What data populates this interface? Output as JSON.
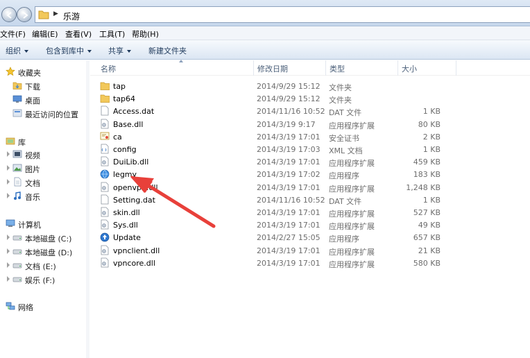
{
  "address": {
    "path_segment": "乐游"
  },
  "menu": [
    {
      "id": "file",
      "label": "文件(F)"
    },
    {
      "id": "edit",
      "label": "编辑(E)"
    },
    {
      "id": "view",
      "label": "查看(V)"
    },
    {
      "id": "tools",
      "label": "工具(T)"
    },
    {
      "id": "help",
      "label": "帮助(H)"
    }
  ],
  "toolbar": {
    "organize": "组织",
    "include_library": "包含到库中",
    "share": "共享",
    "new_folder": "新建文件夹"
  },
  "nav": {
    "favorites": "收藏夹",
    "downloads": "下载",
    "desktop": "桌面",
    "recent": "最近访问的位置",
    "libraries": "库",
    "videos": "视频",
    "pictures": "图片",
    "documents": "文档",
    "music": "音乐",
    "computer": "计算机",
    "drive_c": "本地磁盘 (C:)",
    "drive_d": "本地磁盘 (D:)",
    "drive_e": "文档 (E:)",
    "drive_f": "娱乐 (F:)",
    "network": "网络"
  },
  "columns": {
    "name": "名称",
    "date": "修改日期",
    "type": "类型",
    "size": "大小"
  },
  "files": [
    {
      "name": "tap",
      "date": "2014/9/29 15:12",
      "type": "文件夹",
      "size": "",
      "icon": "folder-icon"
    },
    {
      "name": "tap64",
      "date": "2014/9/29 15:12",
      "type": "文件夹",
      "size": "",
      "icon": "folder-icon"
    },
    {
      "name": "Access.dat",
      "date": "2014/11/16 10:52",
      "type": "DAT 文件",
      "size": "1 KB",
      "icon": "file-icon"
    },
    {
      "name": "Base.dll",
      "date": "2014/3/19 9:17",
      "type": "应用程序扩展",
      "size": "80 KB",
      "icon": "dll-icon"
    },
    {
      "name": "ca",
      "date": "2014/3/19 17:01",
      "type": "安全证书",
      "size": "2 KB",
      "icon": "certificate-icon"
    },
    {
      "name": "config",
      "date": "2014/3/19 17:03",
      "type": "XML 文档",
      "size": "1 KB",
      "icon": "xml-icon"
    },
    {
      "name": "DuiLib.dll",
      "date": "2014/3/19 17:01",
      "type": "应用程序扩展",
      "size": "459 KB",
      "icon": "dll-icon"
    },
    {
      "name": "legmy",
      "date": "2014/3/19 17:02",
      "type": "应用程序",
      "size": "183 KB",
      "icon": "app-globe-icon"
    },
    {
      "name": "openvpn.dll",
      "date": "2014/3/19 17:01",
      "type": "应用程序扩展",
      "size": "1,248 KB",
      "icon": "dll-icon"
    },
    {
      "name": "Setting.dat",
      "date": "2014/11/16 10:52",
      "type": "DAT 文件",
      "size": "1 KB",
      "icon": "file-icon"
    },
    {
      "name": "skin.dll",
      "date": "2014/3/19 17:01",
      "type": "应用程序扩展",
      "size": "527 KB",
      "icon": "dll-icon"
    },
    {
      "name": "Sys.dll",
      "date": "2014/3/19 17:01",
      "type": "应用程序扩展",
      "size": "49 KB",
      "icon": "dll-icon"
    },
    {
      "name": "Update",
      "date": "2014/2/27 15:05",
      "type": "应用程序",
      "size": "657 KB",
      "icon": "update-icon"
    },
    {
      "name": "vpnclient.dll",
      "date": "2014/3/19 17:01",
      "type": "应用程序扩展",
      "size": "21 KB",
      "icon": "dll-icon"
    },
    {
      "name": "vpncore.dll",
      "date": "2014/3/19 17:01",
      "type": "应用程序扩展",
      "size": "580 KB",
      "icon": "dll-icon"
    }
  ],
  "colors": {
    "annotation_arrow": "#e8403a",
    "folder": "#f2c85b",
    "toolbar_text": "#1e395b"
  }
}
